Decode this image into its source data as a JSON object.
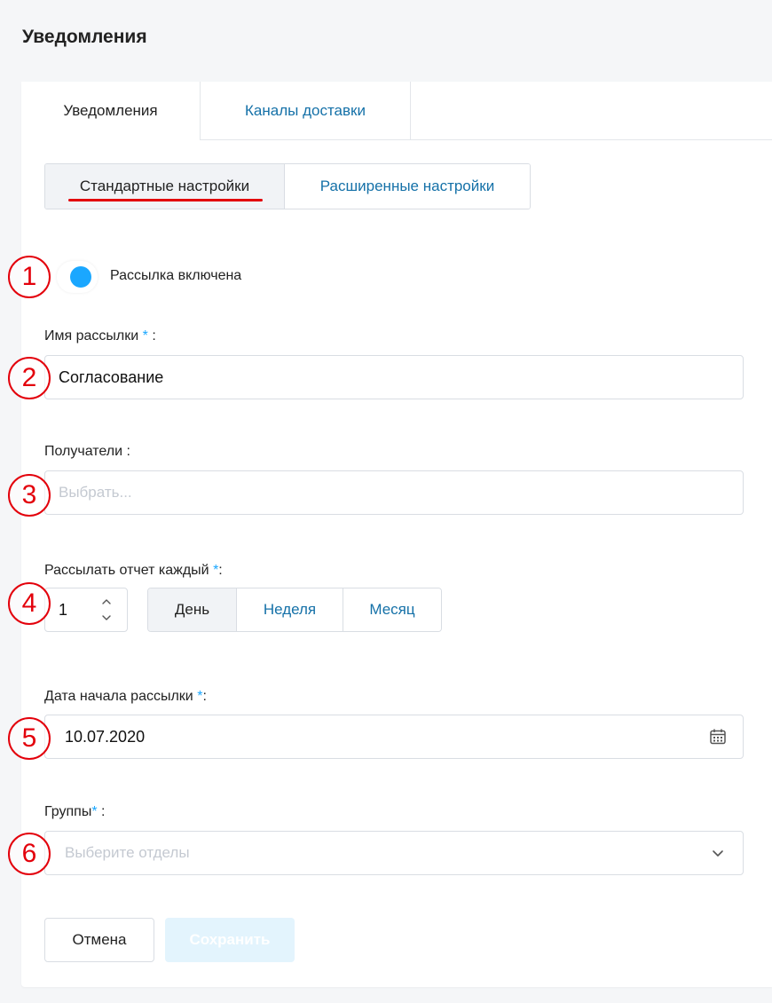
{
  "page": {
    "title": "Уведомления"
  },
  "tabs": [
    {
      "label": "Уведомления",
      "active": true
    },
    {
      "label": "Каналы доставки",
      "active": false
    }
  ],
  "subtabs": [
    {
      "label": "Стандартные настройки",
      "active": true
    },
    {
      "label": "Расширенные настройки",
      "active": false
    }
  ],
  "markers": [
    "1",
    "2",
    "3",
    "4",
    "5",
    "6"
  ],
  "toggle": {
    "label": "Рассылка включена",
    "on": true
  },
  "name_field": {
    "label": "Имя рассылки",
    "required_mark": "*",
    "suffix": " :",
    "value": "Согласование"
  },
  "recipients": {
    "label": "Получатели :",
    "placeholder": "Выбрать..."
  },
  "frequency": {
    "label": "Рассылать отчет каждый",
    "required_mark": "*",
    "suffix": ":",
    "value": "1",
    "options": [
      "День",
      "Неделя",
      "Месяц"
    ],
    "selected": "День"
  },
  "start_date": {
    "label": "Дата начала рассылки",
    "required_mark": "*",
    "suffix": ":",
    "value": "10.07.2020",
    "icon": "calendar-icon"
  },
  "groups": {
    "label": "Группы",
    "required_mark": "*",
    "suffix": " :",
    "placeholder": "Выберите отделы",
    "icon": "chevron-down-icon"
  },
  "actions": {
    "cancel": "Отмена",
    "save": "Сохранить"
  },
  "colors": {
    "accent": "#1aa7ff",
    "link": "#1571a8",
    "marker": "#e3000b"
  }
}
